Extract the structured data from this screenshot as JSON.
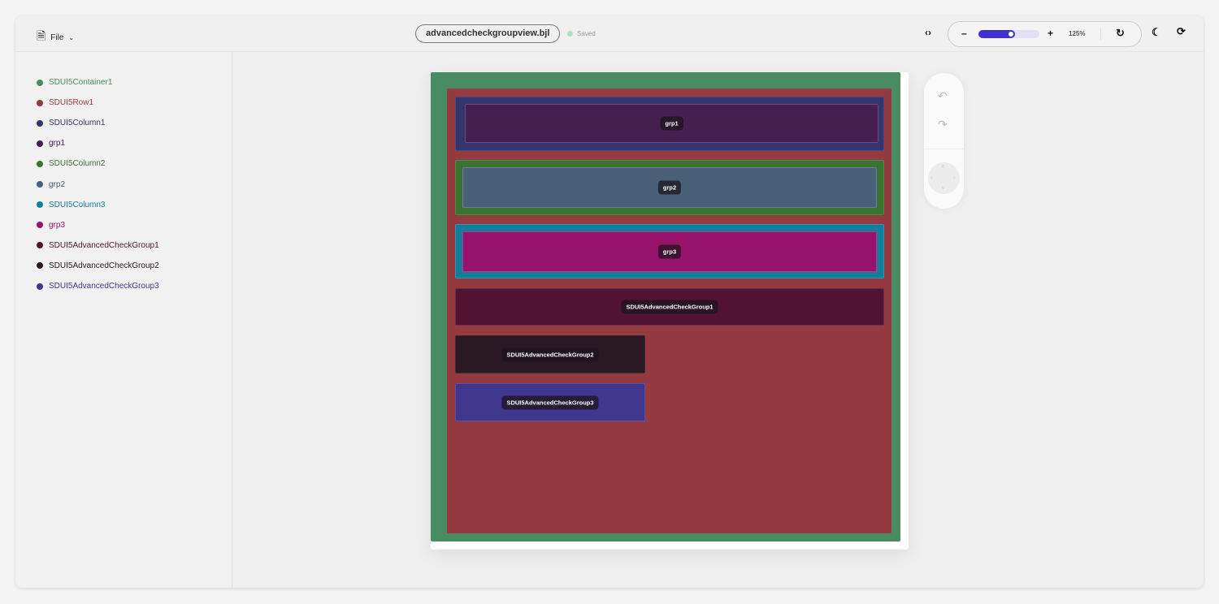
{
  "header": {
    "file_label": "File",
    "filename": "advancedcheckgroupview.bjl",
    "status": "Saved",
    "zoom": "125%",
    "zoom_fraction": 0.6
  },
  "tree": [
    {
      "label": "SDUI5Container1",
      "color": "#4a8c62"
    },
    {
      "label": "SDUI5Row1",
      "color": "#943a40"
    },
    {
      "label": "SDUI5Column1",
      "color": "#33356e"
    },
    {
      "label": "grp1",
      "color": "#45204f"
    },
    {
      "label": "SDUI5Column2",
      "color": "#3a7430"
    },
    {
      "label": "grp2",
      "color": "#4a5f78"
    },
    {
      "label": "SDUI5Column3",
      "color": "#137e9c"
    },
    {
      "label": "grp3",
      "color": "#98136b"
    },
    {
      "label": "SDUI5AdvancedCheckGroup1",
      "color": "#521231"
    },
    {
      "label": "SDUI5AdvancedCheckGroup2",
      "color": "#2a1822"
    },
    {
      "label": "SDUI5AdvancedCheckGroup3",
      "color": "#41368d"
    }
  ],
  "canvas": {
    "grp1": "grp1",
    "grp2": "grp2",
    "grp3": "grp3",
    "acg1": "SDUI5AdvancedCheckGroup1",
    "acg2": "SDUI5AdvancedCheckGroup2",
    "acg3": "SDUI5AdvancedCheckGroup3"
  }
}
